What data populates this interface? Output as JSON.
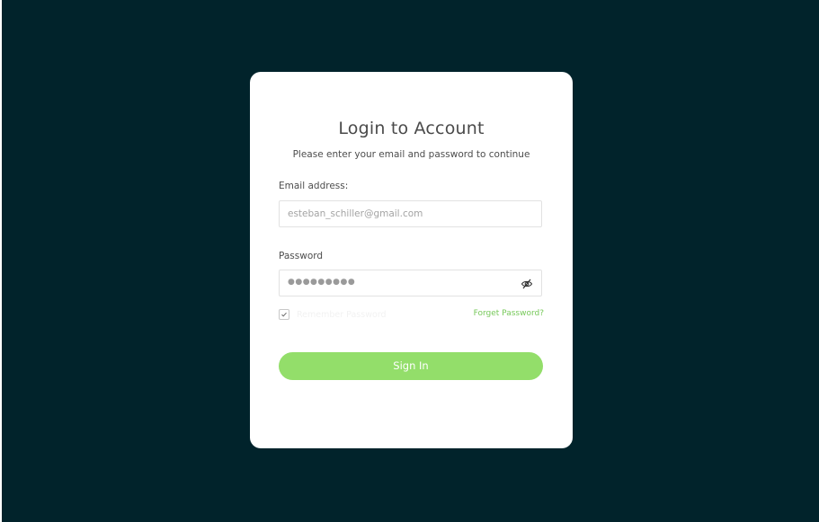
{
  "login": {
    "title": "Login to Account",
    "subtitle": "Please enter your email and password to continue",
    "email_label": "Email address:",
    "email_placeholder": "esteban_schiller@gmail.com",
    "password_label": "Password",
    "password_mask": "●●●●●●●●●",
    "password_toggle_icon": "eye-slash-icon",
    "remember_checked": true,
    "remember_label": "Remember Password",
    "forget_link": "Forget Password?",
    "signin_label": "Sign In"
  },
  "colors": {
    "page_background": "#01232b",
    "card_background": "#ffffff",
    "accent_green": "#93de6a",
    "link_green": "#77c95a",
    "text_dark": "#4a4a4a",
    "placeholder": "#a3a3a3"
  }
}
